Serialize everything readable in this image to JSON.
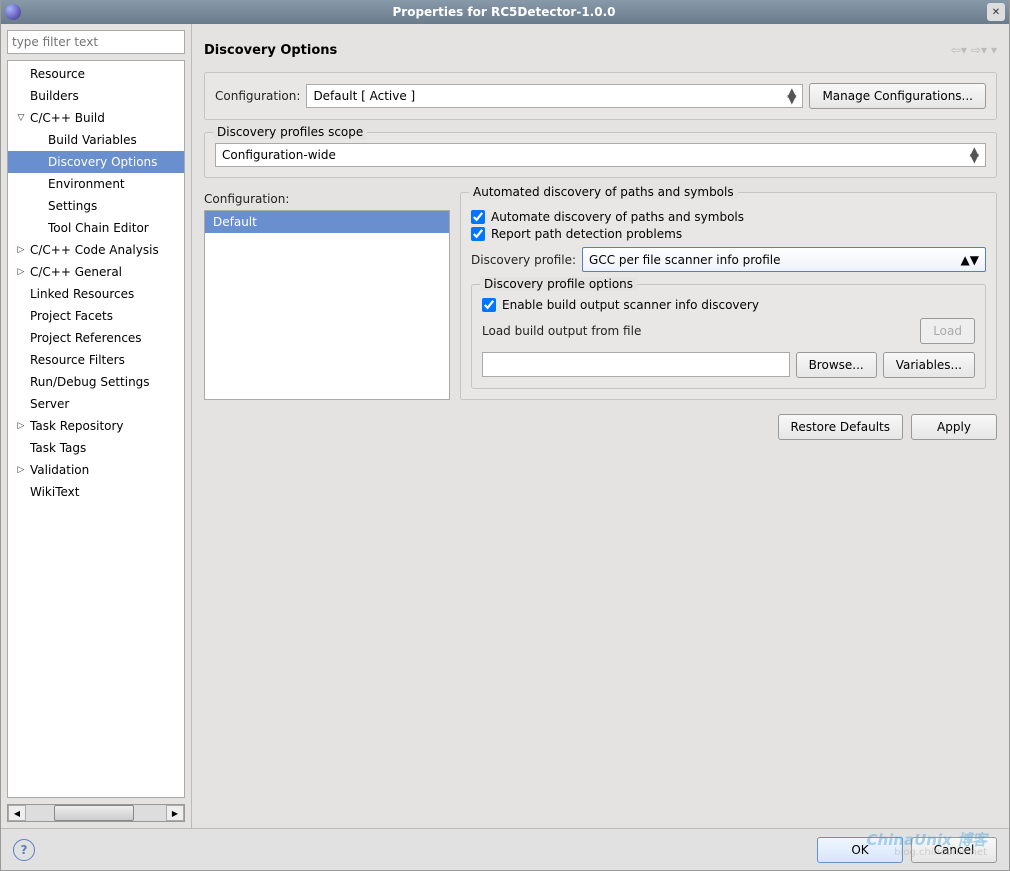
{
  "window": {
    "title": "Properties for RC5Detector-1.0.0"
  },
  "sidebar": {
    "filter_placeholder": "type filter text",
    "items": [
      {
        "label": "Resource",
        "depth": 0,
        "hasChildren": false
      },
      {
        "label": "Builders",
        "depth": 0,
        "hasChildren": false
      },
      {
        "label": "C/C++ Build",
        "depth": 0,
        "hasChildren": true,
        "expanded": true
      },
      {
        "label": "Build Variables",
        "depth": 1
      },
      {
        "label": "Discovery Options",
        "depth": 1,
        "selected": true
      },
      {
        "label": "Environment",
        "depth": 1
      },
      {
        "label": "Settings",
        "depth": 1
      },
      {
        "label": "Tool Chain Editor",
        "depth": 1
      },
      {
        "label": "C/C++ Code Analysis",
        "depth": 0,
        "hasChildren": true,
        "expanded": false
      },
      {
        "label": "C/C++ General",
        "depth": 0,
        "hasChildren": true,
        "expanded": false
      },
      {
        "label": "Linked Resources",
        "depth": 0
      },
      {
        "label": "Project Facets",
        "depth": 0
      },
      {
        "label": "Project References",
        "depth": 0
      },
      {
        "label": "Resource Filters",
        "depth": 0
      },
      {
        "label": "Run/Debug Settings",
        "depth": 0
      },
      {
        "label": "Server",
        "depth": 0
      },
      {
        "label": "Task Repository",
        "depth": 0,
        "hasChildren": true,
        "expanded": false
      },
      {
        "label": "Task Tags",
        "depth": 0
      },
      {
        "label": "Validation",
        "depth": 0,
        "hasChildren": true,
        "expanded": false
      },
      {
        "label": "WikiText",
        "depth": 0
      }
    ]
  },
  "page": {
    "title": "Discovery Options",
    "config_label": "Configuration:",
    "config_value": "Default  [ Active ]",
    "manage_btn": "Manage Configurations...",
    "scope_legend": "Discovery profiles scope",
    "scope_value": "Configuration-wide",
    "config_list_label": "Configuration:",
    "config_list": [
      "Default"
    ],
    "auto_legend": "Automated discovery of paths and symbols",
    "chk_automate": "Automate discovery of paths and symbols",
    "chk_report": "Report path detection problems",
    "profile_label": "Discovery profile:",
    "profile_value": "GCC per file scanner info profile",
    "options_legend": "Discovery profile options",
    "chk_enable_output": "Enable build output scanner info discovery",
    "load_label": "Load build output from file",
    "load_btn": "Load",
    "browse_btn": "Browse...",
    "variables_btn": "Variables...",
    "file_value": "",
    "restore_btn": "Restore Defaults",
    "apply_btn": "Apply",
    "ok_btn": "OK",
    "cancel_btn": "Cancel"
  },
  "watermark": {
    "a": "ChinaUnix 博客",
    "b": "blog.chinaunix.net"
  }
}
